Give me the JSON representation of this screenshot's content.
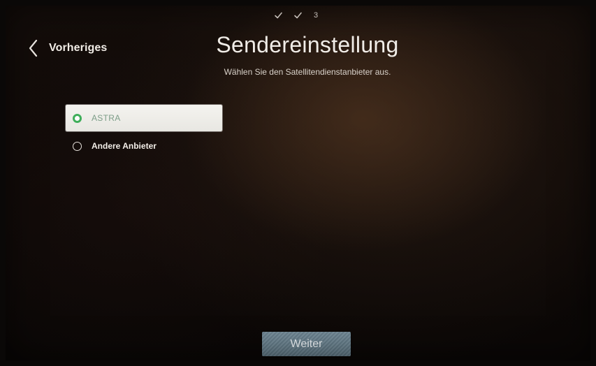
{
  "header": {
    "steps": {
      "step1": "✓",
      "step2": "✓",
      "current": "3"
    },
    "back_label": "Vorheriges",
    "title": "Sendereinstellung",
    "subtitle": "Wählen Sie den Satellitendienstanbieter aus."
  },
  "options": [
    {
      "label": "ASTRA",
      "selected": true
    },
    {
      "label": "Andere Anbieter",
      "selected": false
    }
  ],
  "footer": {
    "next_label": "Weiter"
  },
  "colors": {
    "radio_selected": "#3fae5a",
    "selected_row_bg": "#f4f3ef",
    "next_button_bg": "#6f8794"
  },
  "icons": {
    "back": "chevron-left-icon",
    "step_done": "check-icon",
    "radio_on": "radio-selected-icon",
    "radio_off": "radio-unselected-icon"
  }
}
